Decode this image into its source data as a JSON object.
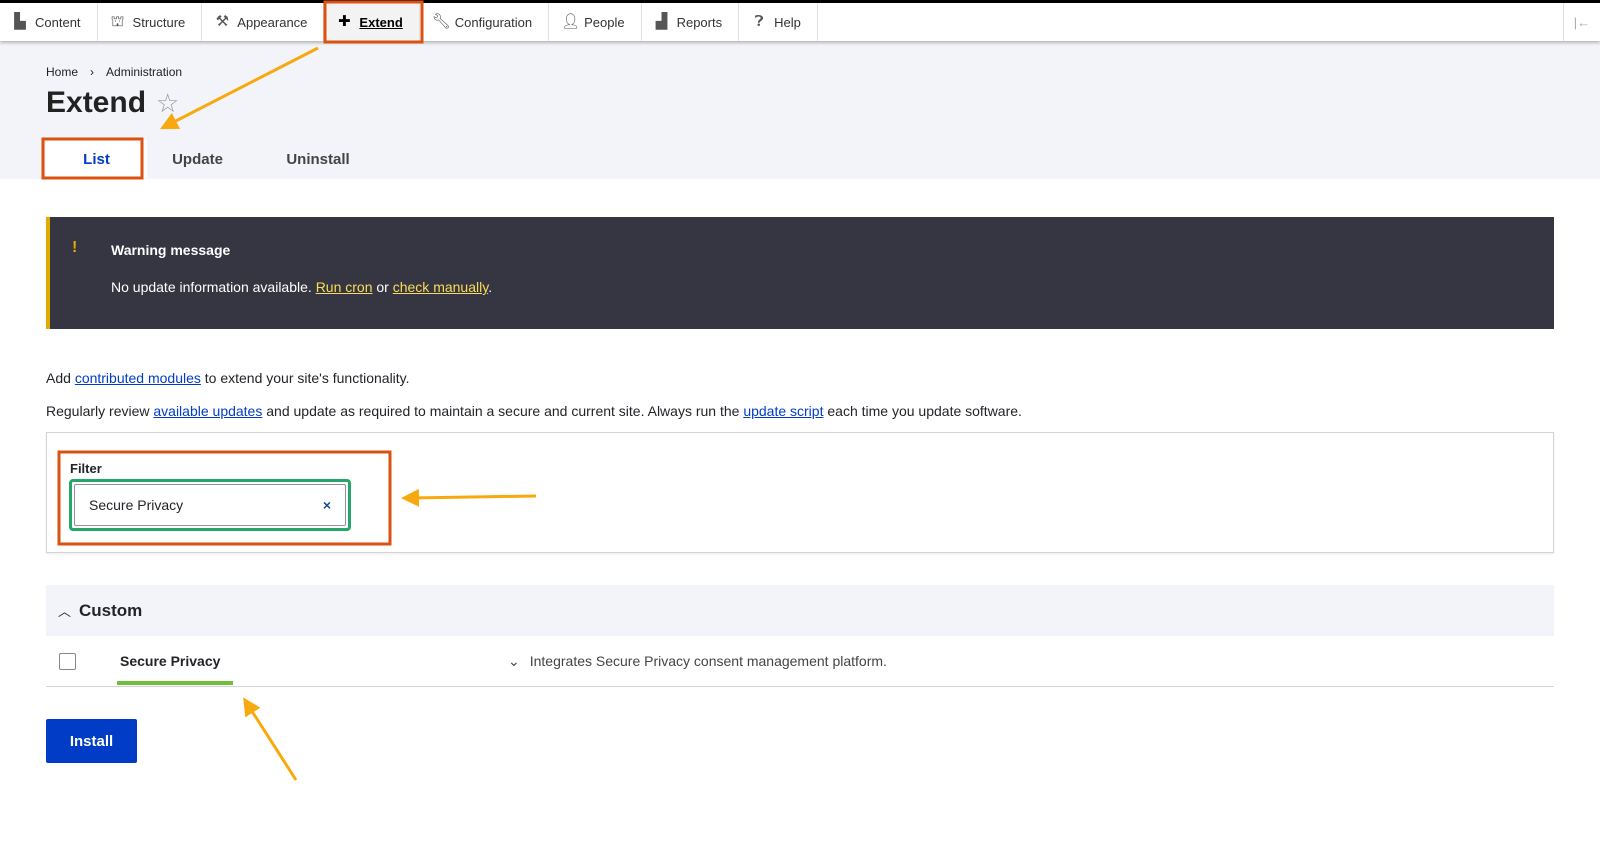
{
  "toolbar": {
    "items": [
      {
        "label": "Content",
        "icon": "file-icon"
      },
      {
        "label": "Structure",
        "icon": "sitemap-icon"
      },
      {
        "label": "Appearance",
        "icon": "brush-icon"
      },
      {
        "label": "Extend",
        "icon": "puzzle-icon",
        "active": true
      },
      {
        "label": "Configuration",
        "icon": "wrench-icon"
      },
      {
        "label": "People",
        "icon": "person-icon"
      },
      {
        "label": "Reports",
        "icon": "bar-chart-icon"
      },
      {
        "label": "Help",
        "icon": "help-icon"
      }
    ]
  },
  "breadcrumb": [
    "Home",
    "Administration"
  ],
  "page_title": "Extend",
  "tabs": [
    "List",
    "Update",
    "Uninstall"
  ],
  "warning": {
    "heading": "Warning message",
    "text_before": "No update information available.",
    "link1": "Run cron",
    "middle": "or",
    "link2": "check manually",
    "end": "."
  },
  "intro1": {
    "before": "Add",
    "link": "contributed modules",
    "after": "to extend your site's functionality."
  },
  "intro2": {
    "before": "Regularly review",
    "link1": "available updates",
    "middle": "and update as required to maintain a secure and current site. Always run the",
    "link2": "update script",
    "after": "each time you update software."
  },
  "filter": {
    "label": "Filter",
    "value": "Secure Privacy",
    "clear": "×"
  },
  "group": {
    "title": "Custom"
  },
  "module": {
    "name": "Secure Privacy",
    "description": "Integrates Secure Privacy consent management platform."
  },
  "install_label": "Install",
  "colors": {
    "accent": "#003cc5",
    "warning_bg": "#353641",
    "annotation": "#d9520f",
    "arrow": "#f7a90f"
  }
}
